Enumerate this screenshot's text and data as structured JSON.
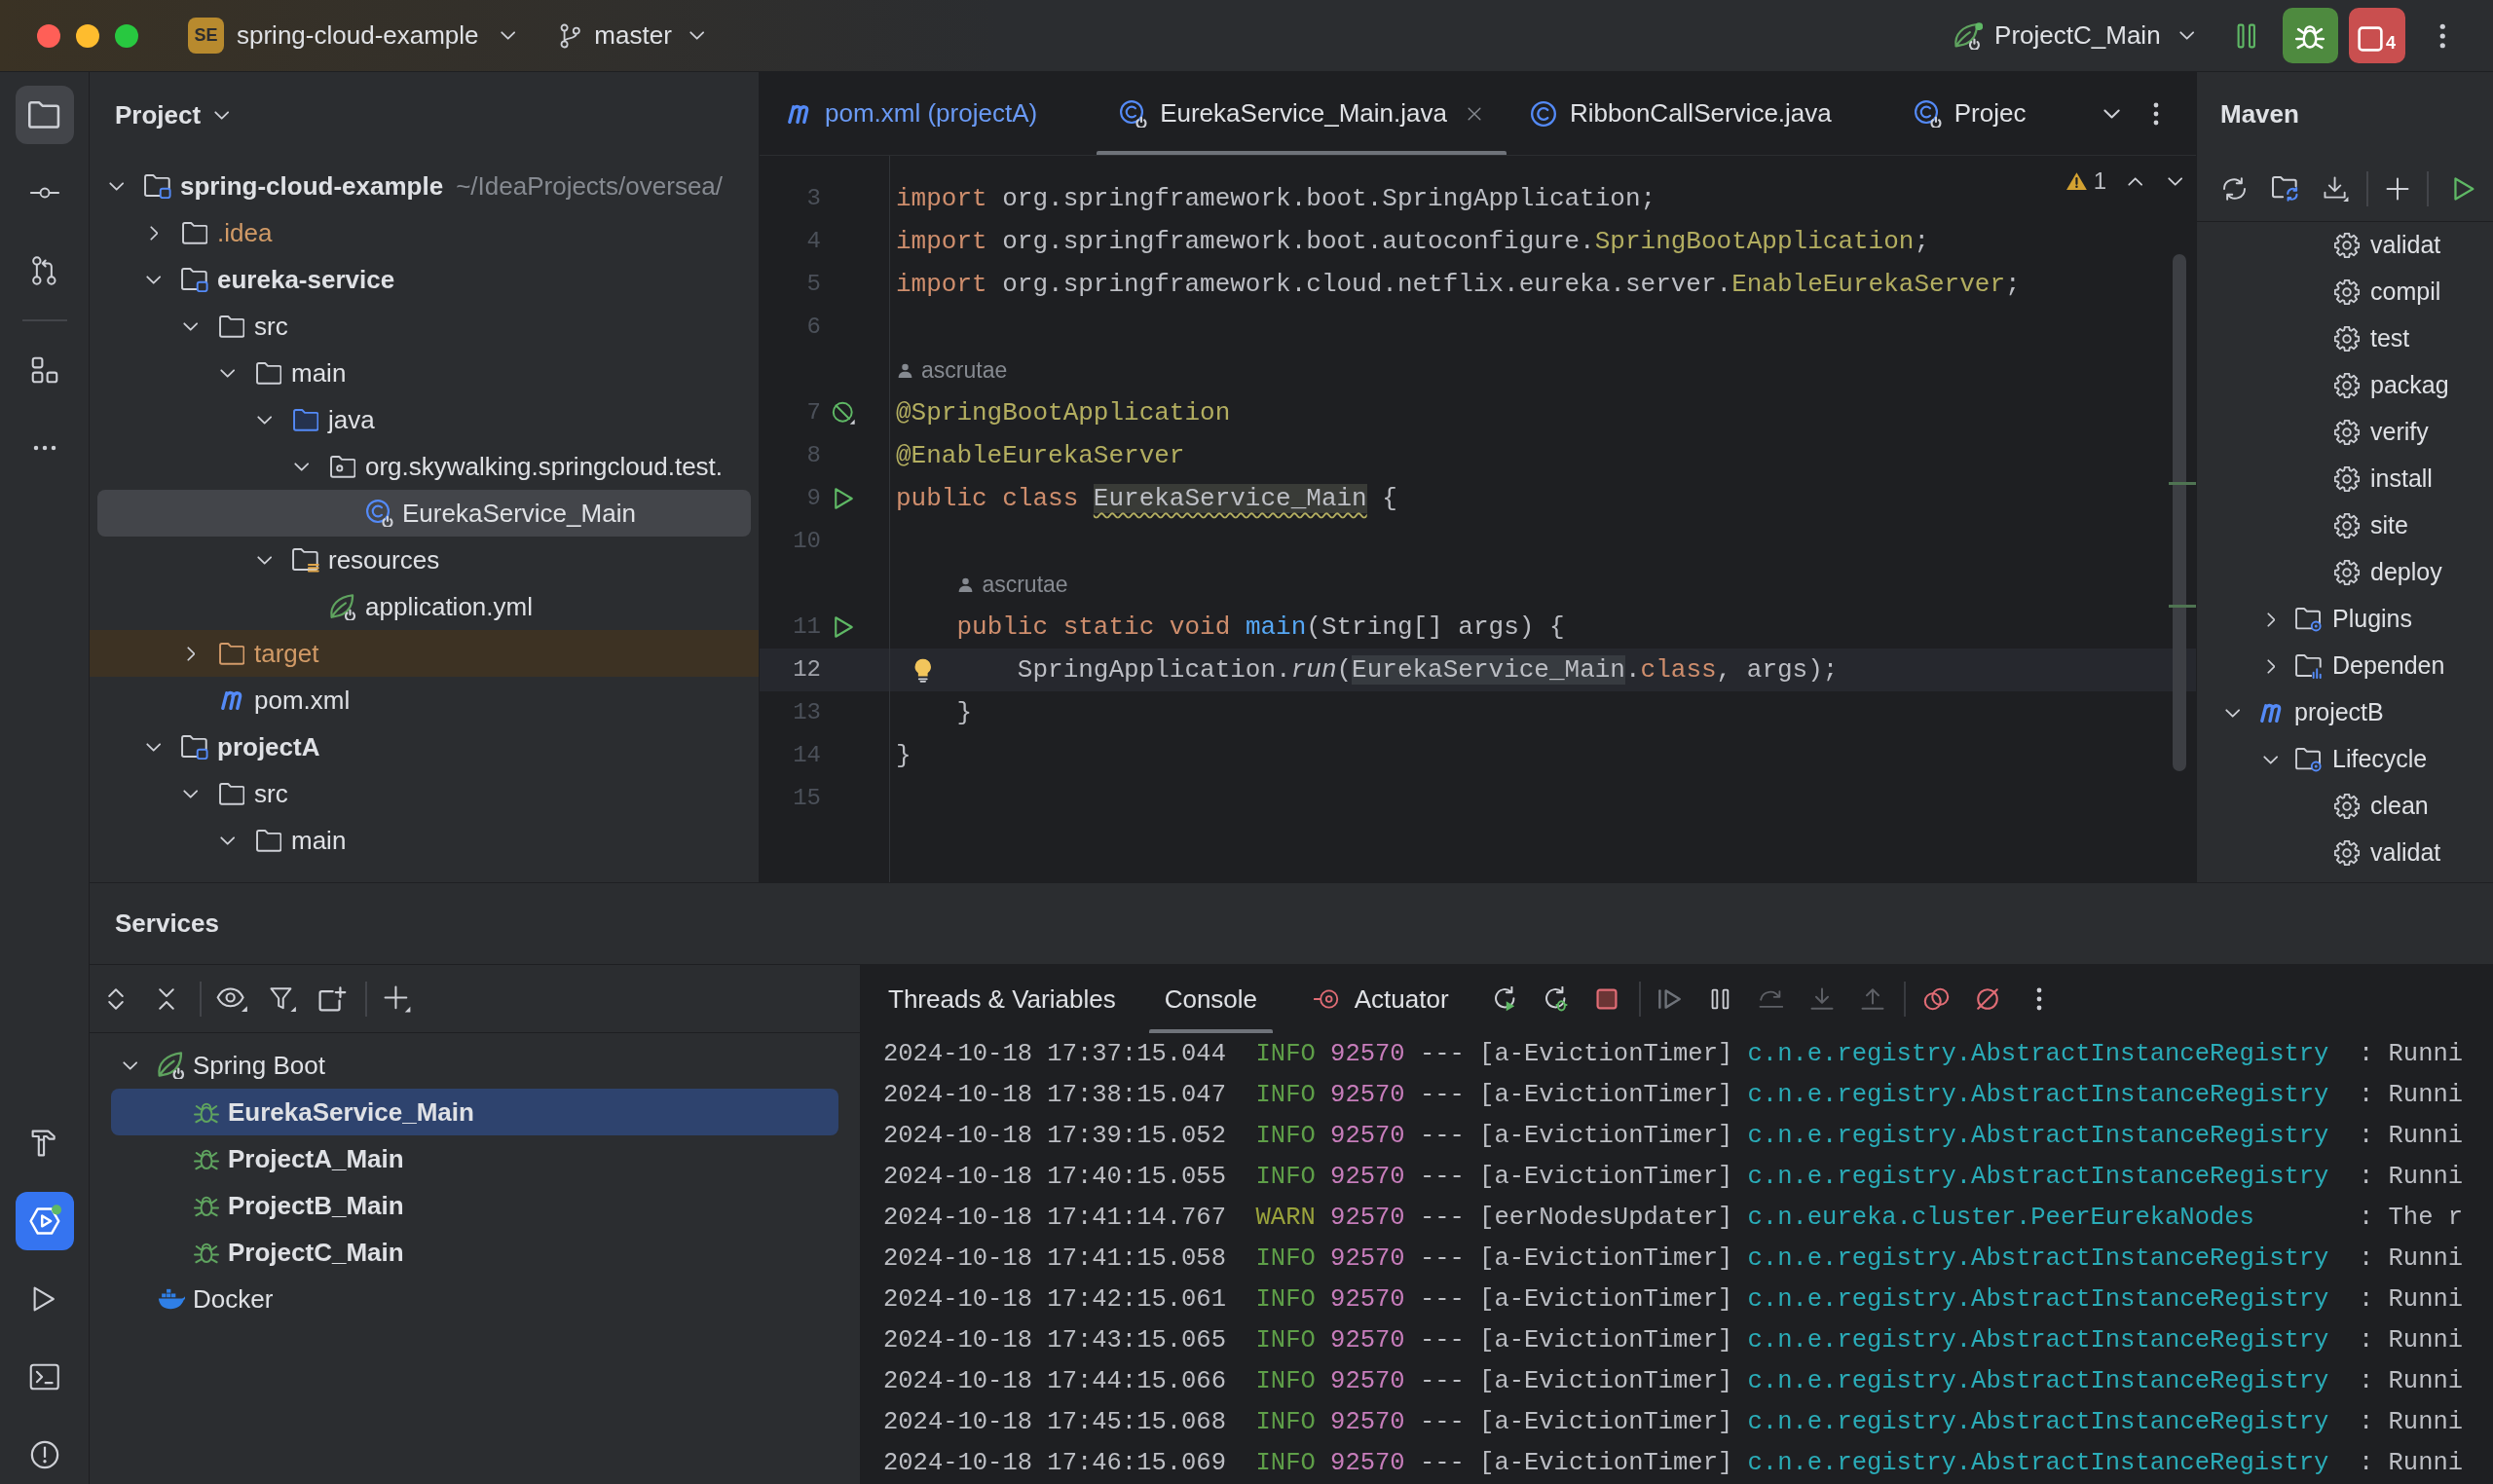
{
  "title_bar": {
    "project_badge": "SE",
    "project": "spring-cloud-example",
    "branch": "master",
    "run_configuration": "ProjectC_Main",
    "stop_count": "4"
  },
  "tool_strip": {
    "top": [
      [
        {
          "kind": "project",
          "selected": true
        },
        {
          "kind": "commit",
          "selected": false
        },
        {
          "kind": "pull-requests",
          "selected": false
        }
      ],
      [
        {
          "kind": "structure",
          "selected": false
        },
        {
          "kind": "more",
          "selected": false
        }
      ]
    ],
    "bottom": [
      {
        "kind": "build",
        "selected": false
      },
      {
        "kind": "services",
        "selected": true
      },
      {
        "kind": "run",
        "selected": false
      },
      {
        "kind": "terminal",
        "selected": false
      },
      {
        "kind": "problems",
        "selected": false
      }
    ]
  },
  "project_panel": {
    "title": "Project",
    "tree": [
      {
        "label": "spring-cloud-example",
        "path": "~/IdeaProjects/oversea/",
        "kind": "module",
        "expanded": true,
        "selected": false,
        "children": [
          {
            "label": ".idea",
            "kind": "ignored-folder",
            "expanded": false,
            "selected": false
          },
          {
            "label": "eureka-service",
            "kind": "module",
            "expanded": true,
            "selected": false,
            "children": [
              {
                "label": "src",
                "kind": "folder",
                "expanded": true,
                "selected": false,
                "children": [
                  {
                    "label": "main",
                    "kind": "folder",
                    "expanded": true,
                    "selected": false,
                    "children": [
                      {
                        "label": "java",
                        "kind": "source-root",
                        "expanded": true,
                        "selected": false,
                        "children": [
                          {
                            "label": "org.skywalking.springcloud.test.",
                            "kind": "package",
                            "expanded": true,
                            "selected": false,
                            "children": [
                              {
                                "label": "EurekaService_Main",
                                "kind": "spring-class",
                                "selected": true
                              }
                            ]
                          }
                        ]
                      },
                      {
                        "label": "resources",
                        "kind": "resources",
                        "expanded": true,
                        "selected": false,
                        "children": [
                          {
                            "label": "application.yml",
                            "kind": "spring-config",
                            "selected": false
                          }
                        ]
                      }
                    ]
                  }
                ]
              },
              {
                "label": "target",
                "kind": "excluded",
                "expanded": false,
                "selected": false
              },
              {
                "label": "pom.xml",
                "kind": "maven",
                "selected": false
              }
            ]
          },
          {
            "label": "projectA",
            "kind": "module",
            "expanded": true,
            "selected": false,
            "children": [
              {
                "label": "src",
                "kind": "folder",
                "expanded": true,
                "selected": false,
                "children": [
                  {
                    "label": "main",
                    "kind": "folder",
                    "expanded": true,
                    "selected": false
                  }
                ]
              }
            ]
          }
        ]
      }
    ]
  },
  "editor": {
    "tabs": [
      {
        "label": "pom.xml (projectA)",
        "kind": "maven",
        "modified": true,
        "selected": false
      },
      {
        "label": "EurekaService_Main.java",
        "kind": "spring-class",
        "modified": false,
        "selected": true
      },
      {
        "label": "RibbonCallService.java",
        "kind": "class",
        "modified": false,
        "selected": false
      },
      {
        "label": "Projec",
        "kind": "spring-class",
        "modified": false,
        "selected": false
      }
    ],
    "warning_count": "1",
    "lines": [
      {
        "kind": "code",
        "number": "3",
        "current": false,
        "intention": false,
        "tokens": [
          {
            "text": "import",
            "kind": "keyword"
          },
          {
            "text": " org.springframework.boot.SpringApplication;"
          }
        ]
      },
      {
        "kind": "code",
        "number": "4",
        "current": false,
        "intention": false,
        "tokens": [
          {
            "text": "import",
            "kind": "keyword"
          },
          {
            "text": " org.springframework.boot.autoconfigure."
          },
          {
            "text": "SpringBootApplication",
            "kind": "annotation"
          },
          {
            "text": ";"
          }
        ]
      },
      {
        "kind": "code",
        "number": "5",
        "current": false,
        "intention": false,
        "tokens": [
          {
            "text": "import",
            "kind": "keyword"
          },
          {
            "text": " org.springframework.cloud.netflix.eureka.server."
          },
          {
            "text": "EnableEurekaServer",
            "kind": "annotation"
          },
          {
            "text": ";"
          }
        ]
      },
      {
        "kind": "code",
        "number": "6",
        "current": false,
        "intention": false
      },
      {
        "kind": "author",
        "text": "ascrutae"
      },
      {
        "kind": "code",
        "number": "7",
        "gutter": {
          "kind": "bean"
        },
        "current": false,
        "intention": false,
        "tokens": [
          {
            "text": "@SpringBootApplication",
            "kind": "annotation"
          }
        ]
      },
      {
        "kind": "code",
        "number": "8",
        "current": false,
        "intention": false,
        "tokens": [
          {
            "text": "@EnableEurekaServer",
            "kind": "annotation"
          }
        ]
      },
      {
        "kind": "code",
        "number": "9",
        "gutter": {
          "kind": "run"
        },
        "current": false,
        "intention": false,
        "tokens": [
          {
            "text": "public ",
            "kind": "keyword"
          },
          {
            "text": "class ",
            "kind": "keyword"
          },
          {
            "text": "EurekaService_Main",
            "kind": "warning-usage"
          },
          {
            "text": " {"
          }
        ]
      },
      {
        "kind": "code",
        "number": "10",
        "current": false,
        "intention": false
      },
      {
        "kind": "author",
        "text": "ascrutae"
      },
      {
        "kind": "code",
        "number": "11",
        "gutter": {
          "kind": "run"
        },
        "current": false,
        "intention": false,
        "tokens": [
          {
            "text": "    public ",
            "kind": "keyword"
          },
          {
            "text": "static ",
            "kind": "keyword"
          },
          {
            "text": "void ",
            "kind": "keyword"
          },
          {
            "text": "main",
            "kind": "method"
          },
          {
            "text": "(String[] args) {"
          }
        ]
      },
      {
        "kind": "code",
        "number": "12",
        "current": true,
        "intention": true,
        "tokens": [
          {
            "text": "        SpringApplication."
          },
          {
            "text": "run",
            "kind": "static-call"
          },
          {
            "text": "("
          },
          {
            "text": "EurekaService_Main",
            "kind": "usage"
          },
          {
            "text": "."
          },
          {
            "text": "class",
            "kind": "keyword"
          },
          {
            "text": ", args);"
          }
        ]
      },
      {
        "kind": "code",
        "number": "13",
        "current": false,
        "intention": false,
        "tokens": [
          {
            "text": "    }"
          }
        ]
      },
      {
        "kind": "code",
        "number": "14",
        "current": false,
        "intention": false,
        "tokens": [
          {
            "text": "}"
          }
        ]
      },
      {
        "kind": "code",
        "number": "15",
        "current": false,
        "intention": false
      }
    ]
  },
  "maven": {
    "title": "Maven",
    "tree": [
      {
        "children": [
          {
            "children": [
              {
                "label": "validat",
                "kind": "goal",
                "selected": false
              },
              {
                "label": "compil",
                "kind": "goal",
                "selected": false
              },
              {
                "label": "test",
                "kind": "goal",
                "selected": false
              },
              {
                "label": "packag",
                "kind": "goal",
                "selected": false
              },
              {
                "label": "verify",
                "kind": "goal",
                "selected": false
              },
              {
                "label": "install",
                "kind": "goal",
                "selected": false
              },
              {
                "label": "site",
                "kind": "goal",
                "selected": false
              },
              {
                "label": "deploy",
                "kind": "goal",
                "selected": false
              }
            ]
          },
          {
            "label": "Plugins",
            "kind": "plugins",
            "expanded": false,
            "selected": false
          },
          {
            "label": "Dependen",
            "kind": "dependencies",
            "expanded": false,
            "selected": false
          }
        ]
      },
      {
        "label": "projectB",
        "kind": "project",
        "expanded": true,
        "selected": false,
        "children": [
          {
            "label": "Lifecycle",
            "kind": "lifecycle",
            "expanded": true,
            "selected": false,
            "children": [
              {
                "label": "clean",
                "kind": "goal",
                "selected": false
              },
              {
                "label": "validat",
                "kind": "goal",
                "selected": false
              }
            ]
          }
        ]
      }
    ]
  },
  "services": {
    "title": "Services",
    "tree": [
      {
        "label": "Spring Boot",
        "kind": "spring-boot",
        "expanded": true,
        "selected": false,
        "children": [
          {
            "label": "EurekaService_Main",
            "kind": "app",
            "selected": true
          },
          {
            "label": "ProjectA_Main",
            "kind": "app",
            "selected": false
          },
          {
            "label": "ProjectB_Main",
            "kind": "app",
            "selected": false
          },
          {
            "label": "ProjectC_Main",
            "kind": "app",
            "selected": false
          }
        ]
      },
      {
        "label": "Docker",
        "kind": "docker",
        "selected": false
      }
    ]
  },
  "console": {
    "tabs": [
      {
        "label": "Threads & Variables",
        "kind": "text",
        "selected": false
      },
      {
        "label": "Console",
        "kind": "text",
        "selected": true
      },
      {
        "label": "Actuator",
        "kind": "icon",
        "selected": false
      }
    ],
    "lines": [
      {
        "kind": "info",
        "time": "2024-10-18 17:37:15.044",
        "level": "INFO",
        "pid": "92570",
        "separator": "---",
        "thread": "[a-EvictionTimer]",
        "logger": "c.n.e.registry.AbstractInstanceRegistry",
        "message": ": Runni"
      },
      {
        "kind": "info",
        "time": "2024-10-18 17:38:15.047",
        "level": "INFO",
        "pid": "92570",
        "separator": "---",
        "thread": "[a-EvictionTimer]",
        "logger": "c.n.e.registry.AbstractInstanceRegistry",
        "message": ": Runni"
      },
      {
        "kind": "info",
        "time": "2024-10-18 17:39:15.052",
        "level": "INFO",
        "pid": "92570",
        "separator": "---",
        "thread": "[a-EvictionTimer]",
        "logger": "c.n.e.registry.AbstractInstanceRegistry",
        "message": ": Runni"
      },
      {
        "kind": "info",
        "time": "2024-10-18 17:40:15.055",
        "level": "INFO",
        "pid": "92570",
        "separator": "---",
        "thread": "[a-EvictionTimer]",
        "logger": "c.n.e.registry.AbstractInstanceRegistry",
        "message": ": Runni"
      },
      {
        "kind": "warn",
        "time": "2024-10-18 17:41:14.767",
        "level": "WARN",
        "pid": "92570",
        "separator": "---",
        "thread": "[eerNodesUpdater]",
        "logger": "c.n.eureka.cluster.PeerEurekaNodes",
        "message": ": The r"
      },
      {
        "kind": "info",
        "time": "2024-10-18 17:41:15.058",
        "level": "INFO",
        "pid": "92570",
        "separator": "---",
        "thread": "[a-EvictionTimer]",
        "logger": "c.n.e.registry.AbstractInstanceRegistry",
        "message": ": Runni"
      },
      {
        "kind": "info",
        "time": "2024-10-18 17:42:15.061",
        "level": "INFO",
        "pid": "92570",
        "separator": "---",
        "thread": "[a-EvictionTimer]",
        "logger": "c.n.e.registry.AbstractInstanceRegistry",
        "message": ": Runni"
      },
      {
        "kind": "info",
        "time": "2024-10-18 17:43:15.065",
        "level": "INFO",
        "pid": "92570",
        "separator": "---",
        "thread": "[a-EvictionTimer]",
        "logger": "c.n.e.registry.AbstractInstanceRegistry",
        "message": ": Runni"
      },
      {
        "kind": "info",
        "time": "2024-10-18 17:44:15.066",
        "level": "INFO",
        "pid": "92570",
        "separator": "---",
        "thread": "[a-EvictionTimer]",
        "logger": "c.n.e.registry.AbstractInstanceRegistry",
        "message": ": Runni"
      },
      {
        "kind": "info",
        "time": "2024-10-18 17:45:15.068",
        "level": "INFO",
        "pid": "92570",
        "separator": "---",
        "thread": "[a-EvictionTimer]",
        "logger": "c.n.e.registry.AbstractInstanceRegistry",
        "message": ": Runni"
      },
      {
        "kind": "info",
        "time": "2024-10-18 17:46:15.069",
        "level": "INFO",
        "pid": "92570",
        "separator": "---",
        "thread": "[a-EvictionTimer]",
        "logger": "c.n.e.registry.AbstractInstanceRegistry",
        "message": ": Runni"
      }
    ]
  }
}
